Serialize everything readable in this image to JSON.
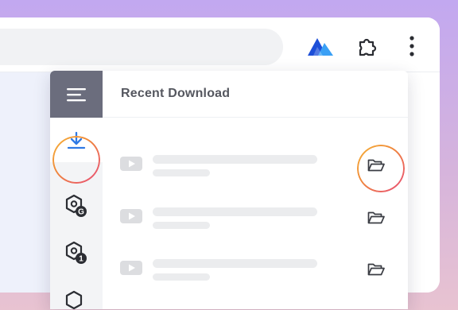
{
  "popup": {
    "title": "Recent Download"
  },
  "toolbar": {
    "icons": [
      "brand-logo-icon",
      "puzzle-extensions-icon",
      "more-vertical-icon"
    ]
  },
  "sidebar": {
    "items": [
      {
        "icon": "menu-icon"
      },
      {
        "icon": "download-icon",
        "active": true
      },
      {
        "icon": "hexagon-search-g-icon",
        "badge": "G"
      },
      {
        "icon": "hexagon-search-1-icon",
        "badge": "1"
      },
      {
        "icon": "hexagon-icon"
      }
    ]
  },
  "downloads": [
    {
      "icon": "youtube-icon",
      "action": "open-folder-icon",
      "highlighted": true
    },
    {
      "icon": "youtube-icon",
      "action": "open-folder-icon"
    },
    {
      "icon": "youtube-icon",
      "action": "open-folder-icon"
    }
  ],
  "colors": {
    "accent": "#2f7ae5",
    "menu_bg": "#6b6d7d",
    "ring_start": "#f6b43a",
    "ring_end": "#e84b7a",
    "brand_dark": "#1d4fd8",
    "brand_light": "#3aa0f5"
  }
}
